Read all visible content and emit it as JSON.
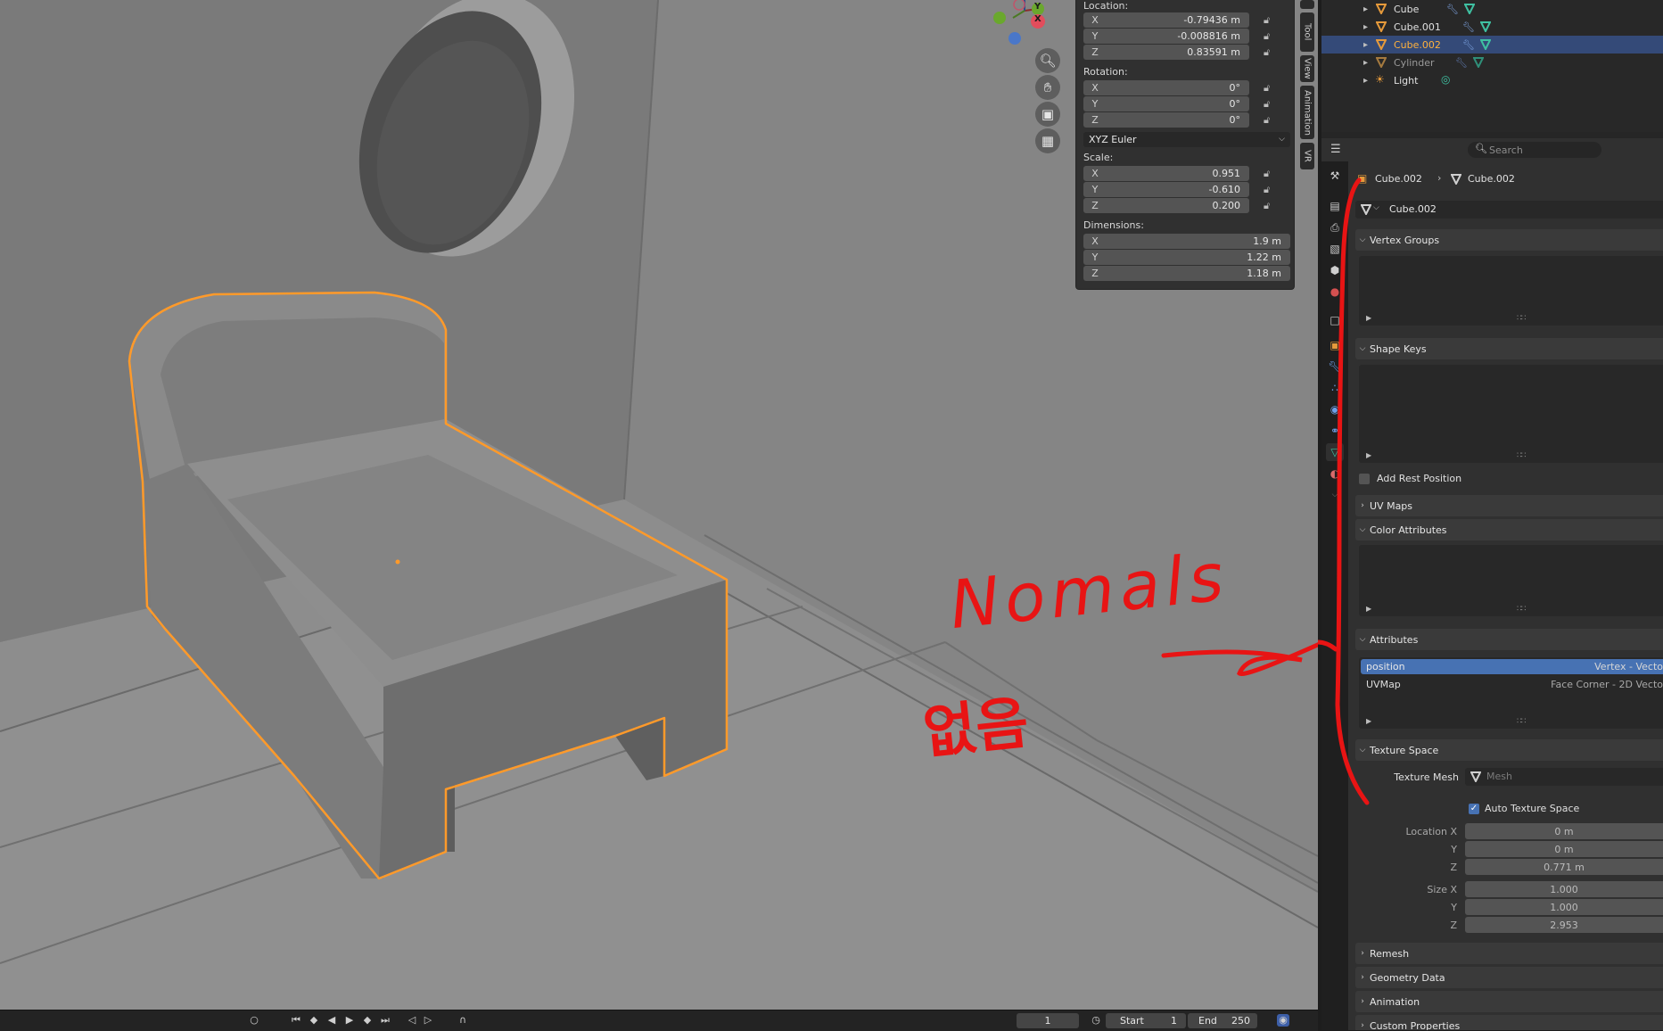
{
  "viewport": {
    "annotation": {
      "line1": "Nomals",
      "line2": "없음",
      "color": "#e81414"
    },
    "gizmo": {
      "y_label": "Y",
      "x_label": "X"
    },
    "nav_icons": [
      "zoom-icon",
      "hand-pan-icon",
      "camera-icon",
      "grid-icon"
    ]
  },
  "npanel": {
    "location_label": "Location:",
    "location": [
      {
        "axis": "X",
        "value": "-0.79436 m"
      },
      {
        "axis": "Y",
        "value": "-0.008816 m"
      },
      {
        "axis": "Z",
        "value": "0.83591 m"
      }
    ],
    "rotation_label": "Rotation:",
    "rotation": [
      {
        "axis": "X",
        "value": "0°"
      },
      {
        "axis": "Y",
        "value": "0°"
      },
      {
        "axis": "Z",
        "value": "0°"
      }
    ],
    "rotation_mode": "XYZ Euler",
    "scale_label": "Scale:",
    "scale": [
      {
        "axis": "X",
        "value": "0.951"
      },
      {
        "axis": "Y",
        "value": "-0.610"
      },
      {
        "axis": "Z",
        "value": "0.200"
      }
    ],
    "dimensions_label": "Dimensions:",
    "dimensions": [
      {
        "axis": "X",
        "value": "1.9 m"
      },
      {
        "axis": "Y",
        "value": "1.22 m"
      },
      {
        "axis": "Z",
        "value": "1.18 m"
      }
    ]
  },
  "side_tabs": [
    "Tool",
    "View",
    "Animation",
    "VR"
  ],
  "timeline": {
    "frame": "1",
    "start_label": "Start",
    "start": "1",
    "end_label": "End",
    "end": "250"
  },
  "outliner": {
    "items": [
      {
        "name": "Cube",
        "selected": false,
        "dim": false
      },
      {
        "name": "Cube.001",
        "selected": false,
        "dim": false
      },
      {
        "name": "Cube.002",
        "selected": true,
        "dim": false
      },
      {
        "name": "Cylinder",
        "selected": false,
        "dim": true
      },
      {
        "name": "Light",
        "selected": false,
        "dim": false
      }
    ]
  },
  "properties": {
    "search_placeholder": "Search",
    "breadcrumb_object": "Cube.002",
    "breadcrumb_mesh": "Cube.002",
    "mesh_name": "Cube.002",
    "sections": {
      "vertex_groups": "Vertex Groups",
      "shape_keys": "Shape Keys",
      "add_rest_position": "Add Rest Position",
      "uv_maps": "UV Maps",
      "color_attributes": "Color Attributes",
      "attributes": "Attributes",
      "texture_space": "Texture Space",
      "remesh": "Remesh",
      "geometry_data": "Geometry Data",
      "animation": "Animation",
      "custom_properties": "Custom Properties"
    },
    "attributes": [
      {
        "name": "position",
        "domain": "Vertex - Vecto",
        "selected": true
      },
      {
        "name": "UVMap",
        "domain": "Face Corner - 2D Vecto",
        "selected": false
      }
    ],
    "texture_space": {
      "texture_mesh_label": "Texture Mesh",
      "texture_mesh_placeholder": "Mesh",
      "auto_label": "Auto Texture Space",
      "location_x_label": "Location X",
      "location_x": "0 m",
      "location_y_label": "Y",
      "location_y": "0 m",
      "location_z_label": "Z",
      "location_z": "0.771 m",
      "size_x_label": "Size X",
      "size_x": "1.000",
      "size_y_label": "Y",
      "size_y": "1.000",
      "size_z_label": "Z",
      "size_z": "2.953"
    }
  },
  "colors": {
    "selection_outline": "#ff9a2a",
    "accent_blue": "#4772b3",
    "outliner_sel": "#344a78",
    "mesh_green": "#3fc1a2",
    "object_orange": "#e69a3b"
  }
}
